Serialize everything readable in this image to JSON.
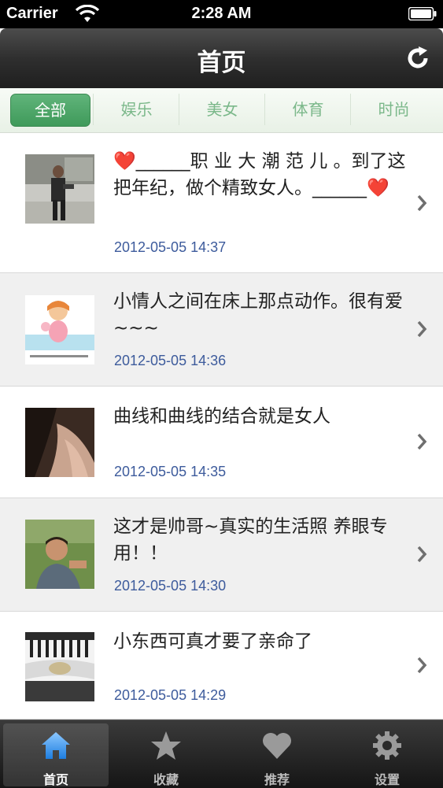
{
  "status_bar": {
    "carrier": "Carrier",
    "time": "2:28 AM"
  },
  "nav": {
    "title": "首页"
  },
  "tabs": [
    {
      "label": "全部"
    },
    {
      "label": "娱乐"
    },
    {
      "label": "美女"
    },
    {
      "label": "体育"
    },
    {
      "label": "时尚"
    }
  ],
  "list": [
    {
      "title": "❤️______职 业 大 潮 范 儿 。到了这把年纪，做个精致女人。______❤️",
      "date": "2012-05-05 14:37"
    },
    {
      "title": "小情人之间在床上那点动作。很有爱~~~",
      "date": "2012-05-05 14:36"
    },
    {
      "title": "曲线和曲线的结合就是女人",
      "date": "2012-05-05 14:35"
    },
    {
      "title": "这才是帅哥~真实的生活照 养眼专用！！",
      "date": "2012-05-05 14:30"
    },
    {
      "title": "小东西可真才要了亲命了",
      "date": "2012-05-05 14:29"
    }
  ],
  "tabbar": [
    {
      "label": "首页",
      "icon": "home-icon"
    },
    {
      "label": "收藏",
      "icon": "star-icon"
    },
    {
      "label": "推荐",
      "icon": "heart-icon"
    },
    {
      "label": "设置",
      "icon": "gear-icon"
    }
  ],
  "colors": {
    "accent_green": "#4aa664",
    "date_blue": "#3d5b9c",
    "nav_dark": "#2f2f2f"
  }
}
